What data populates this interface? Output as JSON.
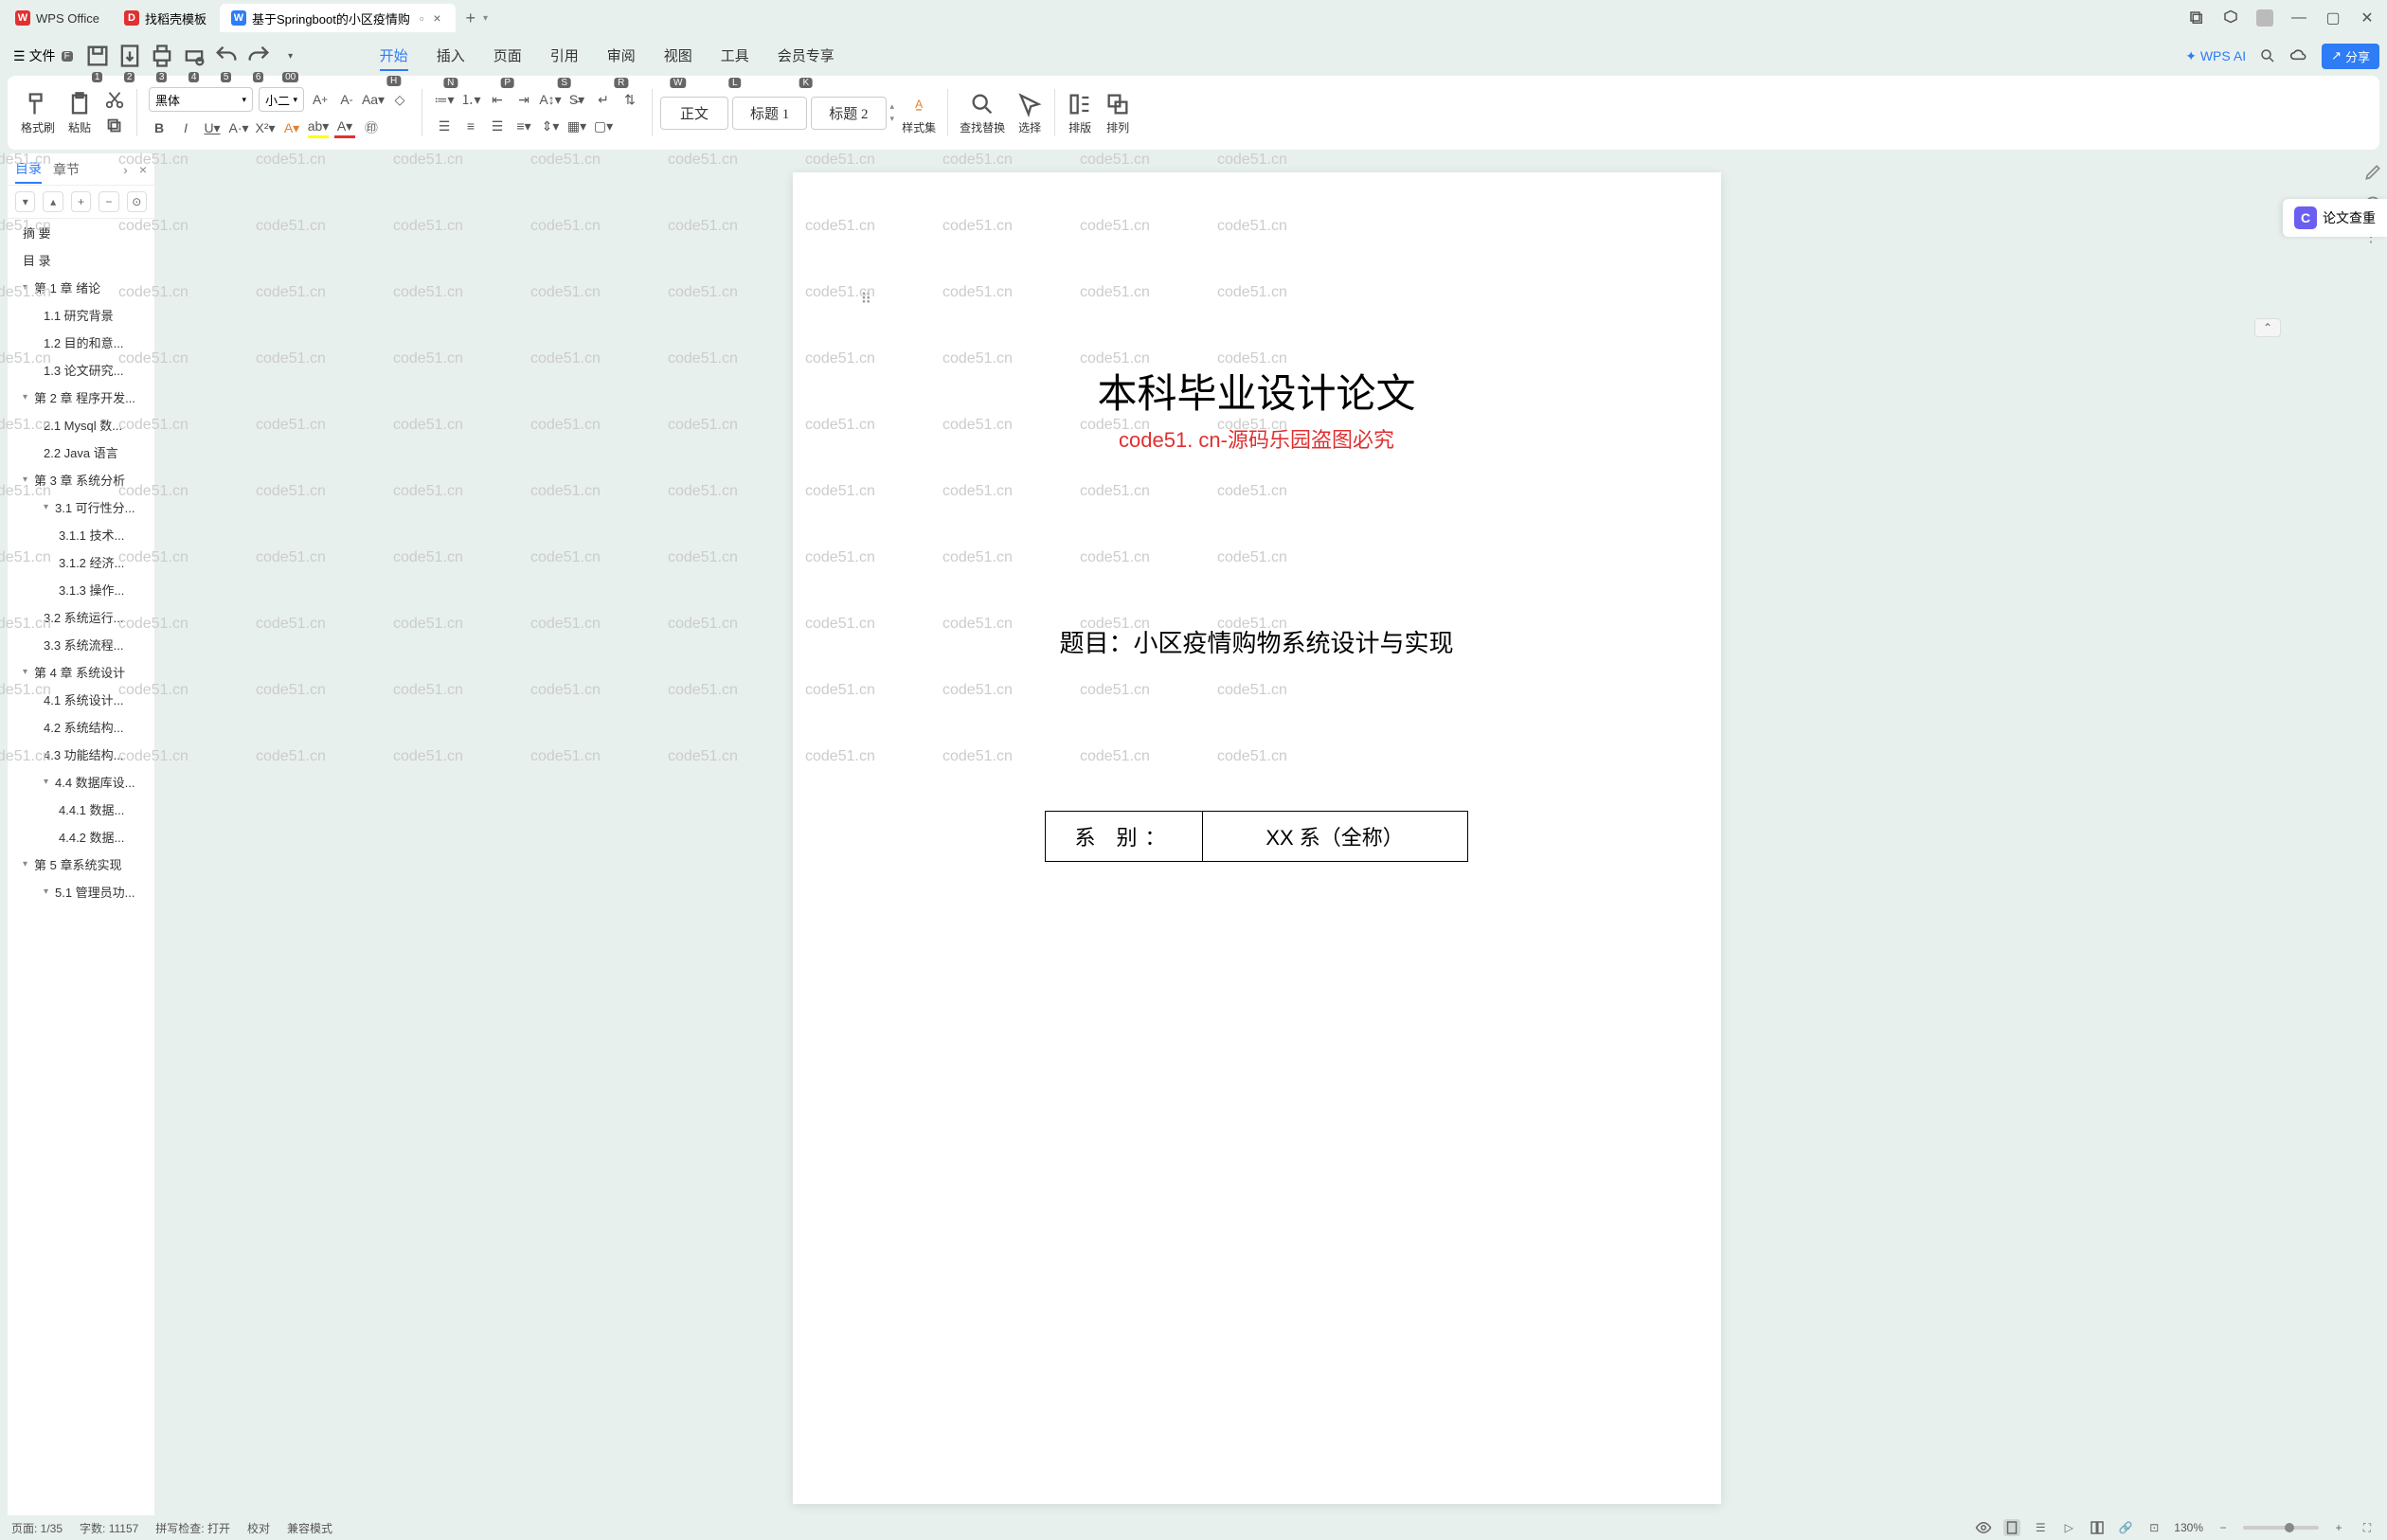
{
  "titlebar": {
    "app_name": "WPS Office",
    "tabs": [
      {
        "label": "找稻壳模板",
        "icon_bg": "#e03030",
        "icon_letter": "D"
      },
      {
        "label": "基于Springboot的小区疫情购",
        "icon_bg": "#2e7cf6",
        "icon_letter": "W",
        "active": true
      }
    ]
  },
  "menubar": {
    "file_label": "文件",
    "file_key": "F",
    "qat_keys": [
      "1",
      "2",
      "3",
      "4",
      "5",
      "6",
      "00"
    ],
    "menus": [
      {
        "label": "开始",
        "key": "H",
        "active": true
      },
      {
        "label": "插入",
        "key": "N"
      },
      {
        "label": "页面",
        "key": "P"
      },
      {
        "label": "引用",
        "key": "S"
      },
      {
        "label": "审阅",
        "key": "R"
      },
      {
        "label": "视图",
        "key": "W"
      },
      {
        "label": "工具",
        "key": "L"
      },
      {
        "label": "会员专享",
        "key": "K"
      }
    ],
    "wps_ai": "WPS AI",
    "share": "分享"
  },
  "ribbon": {
    "format_painter": "格式刷",
    "paste": "粘贴",
    "font_name": "黑体",
    "font_size": "小二",
    "styles": [
      "正文",
      "标题 1",
      "标题 2"
    ],
    "style_set": "样式集",
    "find_replace": "查找替换",
    "select": "选择",
    "arrange": "排版",
    "order": "排列"
  },
  "sidepanel": {
    "tab1": "目录",
    "tab2": "章节",
    "toc": [
      {
        "level": 1,
        "text": "摘  要"
      },
      {
        "level": 1,
        "text": "目  录"
      },
      {
        "level": 1,
        "text": "第 1 章  绪论",
        "arrow": true
      },
      {
        "level": 2,
        "text": "1.1 研究背景"
      },
      {
        "level": 2,
        "text": "1.2 目的和意..."
      },
      {
        "level": 2,
        "text": "1.3 论文研究..."
      },
      {
        "level": 1,
        "text": "第 2 章  程序开发...",
        "arrow": true
      },
      {
        "level": 2,
        "text": "2.1 Mysql 数..."
      },
      {
        "level": 2,
        "text": "2.2 Java 语言"
      },
      {
        "level": 1,
        "text": "第 3 章  系统分析",
        "arrow": true
      },
      {
        "level": 2,
        "text": "3.1 可行性分...",
        "arrow": true
      },
      {
        "level": 3,
        "text": "3.1.1 技术..."
      },
      {
        "level": 3,
        "text": "3.1.2 经济..."
      },
      {
        "level": 3,
        "text": "3.1.3 操作..."
      },
      {
        "level": 2,
        "text": "3.2 系统运行..."
      },
      {
        "level": 2,
        "text": "3.3 系统流程..."
      },
      {
        "level": 1,
        "text": "第 4 章  系统设计",
        "arrow": true
      },
      {
        "level": 2,
        "text": "4.1 系统设计..."
      },
      {
        "level": 2,
        "text": "4.2 系统结构..."
      },
      {
        "level": 2,
        "text": "4.3 功能结构..."
      },
      {
        "level": 2,
        "text": "4.4 数据库设...",
        "arrow": true
      },
      {
        "level": 3,
        "text": "4.4.1 数据..."
      },
      {
        "level": 3,
        "text": "4.4.2 数据..."
      },
      {
        "level": 1,
        "text": "第 5 章系统实现",
        "arrow": true
      },
      {
        "level": 2,
        "text": "5.1 管理员功...",
        "arrow": true
      }
    ]
  },
  "document": {
    "title": "本科毕业设计论文",
    "watermark_red": "code51. cn-源码乐园盗图必究",
    "subject": "题目：小区疫情购物系统设计与实现",
    "info_label": "系        别：",
    "info_value": "XX 系（全称）",
    "bg_watermark": "code51.cn"
  },
  "side_badge": "论文查重",
  "statusbar": {
    "page": "页面: 1/35",
    "words": "字数: 11157",
    "spell": "拼写检查: 打开",
    "proof": "校对",
    "compat": "兼容模式",
    "zoom": "130%"
  }
}
